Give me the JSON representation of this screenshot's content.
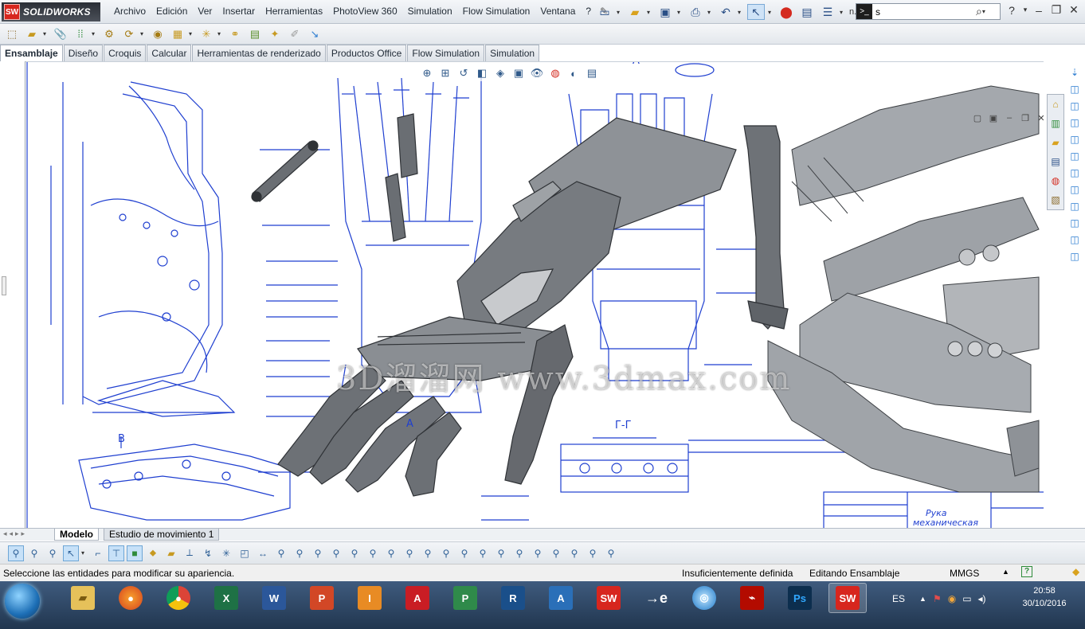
{
  "app": {
    "logo_text": "SOLIDWORKS",
    "logo_badge": "SW"
  },
  "menu": [
    "Archivo",
    "Edición",
    "Ver",
    "Insertar",
    "Herramientas",
    "PhotoView 360",
    "Simulation",
    "Flow Simulation",
    "Ventana",
    "?"
  ],
  "search": {
    "value": "s",
    "overflow_text": "n..."
  },
  "command_tabs": [
    "Ensamblaje",
    "Diseño",
    "Croquis",
    "Calcular",
    "Herramientas de renderizado",
    "Productos Office",
    "Flow Simulation",
    "Simulation"
  ],
  "active_tab": "Ensamblaje",
  "model_tabs": [
    "Modelo",
    "Estudio de movimiento 1"
  ],
  "status": {
    "message": "Seleccione las entidades para modificar su apariencia.",
    "definition": "Insuficientemente definida",
    "mode": "Editando Ensamblaje",
    "units": "MMGS"
  },
  "drawing_labels": {
    "section_a": "A",
    "section_b": "B",
    "section_gg": "Г-Г",
    "title_block_1": "Рука",
    "title_block_2": "механическая",
    "watermark": "3D溜溜网 www.3dmax.com"
  },
  "taskbar": {
    "apps": [
      "file-explorer",
      "firefox",
      "chrome",
      "excel",
      "word",
      "powerpoint",
      "inventor",
      "autocad",
      "project",
      "revit",
      "autodesk-3d",
      "solidworks",
      "edrawings",
      "network",
      "acrobat",
      "photoshop",
      "solidworks-active"
    ],
    "language": "ES",
    "time": "20:58",
    "date": "30/10/2016"
  },
  "colors": {
    "drawing_blue": "#1f3fd0",
    "model_gray": "#6f7378",
    "sw_red": "#d7261e",
    "taskbar": "#2b4566"
  }
}
